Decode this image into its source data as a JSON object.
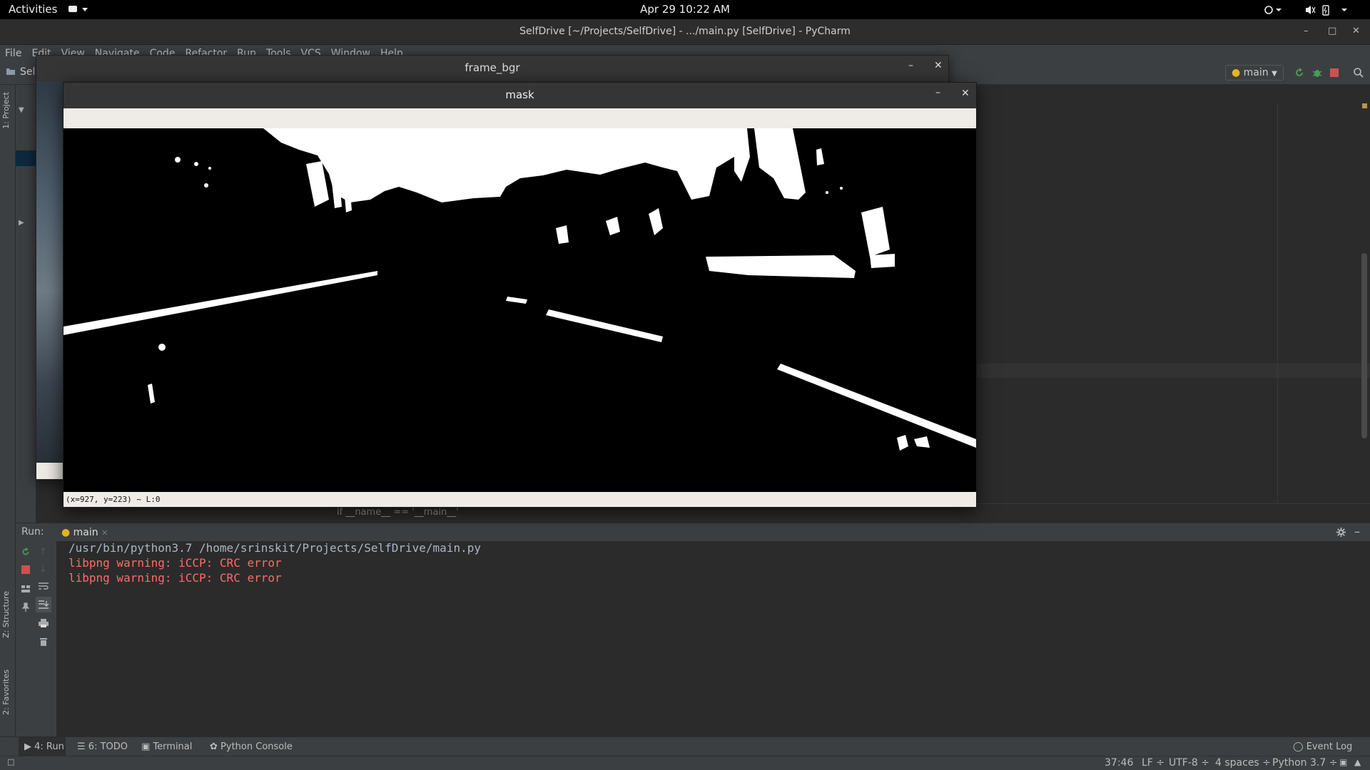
{
  "topbar": {
    "activities": "Activities",
    "clock": "Apr 29  10:22 AM"
  },
  "window": {
    "title": "SelfDrive [~/Projects/SelfDrive] - .../main.py [SelfDrive] - PyCharm"
  },
  "menu": [
    "File",
    "Edit",
    "View",
    "Navigate",
    "Code",
    "Refactor",
    "Run",
    "Tools",
    "VCS",
    "Window",
    "Help"
  ],
  "navbar": {
    "project_crumb": "Sel",
    "run_config": "main"
  },
  "left_tabs": {
    "project": "1: Project",
    "structure": "Z: Structure",
    "favorites": "2: Favorites"
  },
  "editor": {
    "breadcrumb": "if __name__ == '__main__'"
  },
  "frame_window": {
    "title": "frame_bgr"
  },
  "mask_window": {
    "title": "mask",
    "status": "(x=927, y=223) ~ L:0"
  },
  "run_panel": {
    "label": "Run:",
    "tab": "main",
    "lines": [
      {
        "text": "/usr/bin/python3.7 /home/srinskit/Projects/SelfDrive/main.py",
        "kind": "cmd"
      },
      {
        "text": "libpng warning: iCCP: CRC error",
        "kind": "err"
      },
      {
        "text": "libpng warning: iCCP: CRC error",
        "kind": "err"
      }
    ]
  },
  "bottom_tabs": {
    "run": "4: Run",
    "todo": "6: TODO",
    "terminal": "Terminal",
    "python_console": "Python Console",
    "event_log": "Event Log"
  },
  "status": {
    "position": "37:46",
    "line_sep": "LF ÷",
    "encoding": "UTF-8 ÷",
    "indent": "4 spaces ÷",
    "interpreter": "Python 3.7 ÷"
  },
  "colors": {
    "accent_run": "#499c54",
    "stop": "#c75450",
    "error_text": "#ff6b68"
  }
}
